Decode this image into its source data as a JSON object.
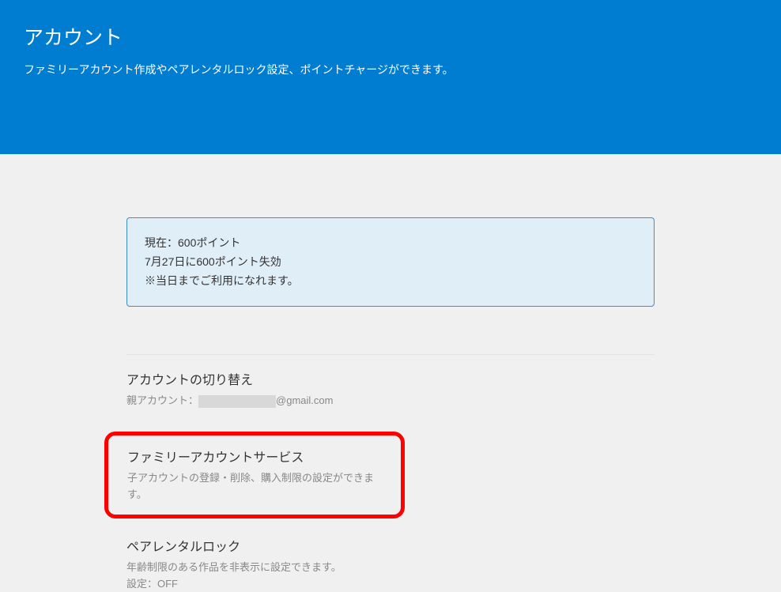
{
  "header": {
    "title": "アカウント",
    "subtitle": "ファミリーアカウント作成やペアレンタルロック設定、ポイントチャージができます。"
  },
  "points": {
    "current": "現在：600ポイント",
    "expiry": "7月27日に600ポイント失効",
    "note": "※当日までご利用になれます。"
  },
  "sections": {
    "switch": {
      "title": "アカウントの切り替え",
      "label": "親アカウント：",
      "domain": "@gmail.com"
    },
    "family": {
      "title": "ファミリーアカウントサービス",
      "desc": "子アカウントの登録・削除、購入制限の設定ができます。"
    },
    "parental": {
      "title": "ペアレンタルロック",
      "desc": "年齢制限のある作品を非表示に設定できます。",
      "status": "設定：OFF"
    }
  }
}
